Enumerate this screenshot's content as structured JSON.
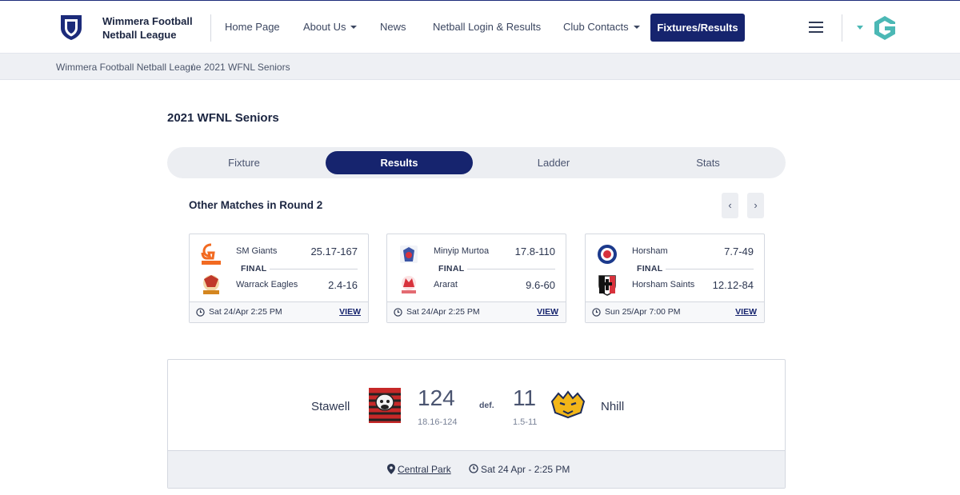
{
  "header": {
    "league_name": "Wimmera Football Netball League",
    "nav": [
      {
        "label": "Home Page",
        "has_dropdown": false
      },
      {
        "label": "About Us",
        "has_dropdown": true
      },
      {
        "label": "News",
        "has_dropdown": false
      },
      {
        "label": "Netball Login & Results",
        "has_dropdown": false
      },
      {
        "label": "Club Contacts",
        "has_dropdown": true
      }
    ],
    "cta_label": "Fixtures/Results",
    "icons": {
      "logo": "shield-icon",
      "menu": "hamburger-menu-icon",
      "brand": "gameday-g-logo"
    }
  },
  "breadcrumb": {
    "items": [
      "Wimmera Football Netball League",
      "2021 WFNL Seniors"
    ],
    "separator": "/"
  },
  "page": {
    "title": "2021 WFNL Seniors",
    "tabs": [
      "Fixture",
      "Results",
      "Ladder",
      "Stats"
    ],
    "active_tab": "Results"
  },
  "other_matches": {
    "title": "Other Matches in Round 2",
    "prev_icon": "‹",
    "next_icon": "›",
    "view_label": "VIEW",
    "matches": [
      {
        "status": "FINAL",
        "home": {
          "name": "SM Giants",
          "score": "25.17-167"
        },
        "away": {
          "name": "Warrack Eagles",
          "score": "2.4-16"
        },
        "datetime": "Sat 24/Apr  2:25 PM"
      },
      {
        "status": "FINAL",
        "home": {
          "name": "Minyip Murtoa",
          "score": "17.8-110"
        },
        "away": {
          "name": "Ararat",
          "score": "9.6-60"
        },
        "datetime": "Sat 24/Apr  2:25 PM"
      },
      {
        "status": "FINAL",
        "home": {
          "name": "Horsham",
          "score": "7.7-49"
        },
        "away": {
          "name": "Horsham Saints",
          "score": "12.12-84"
        },
        "datetime": "Sun 25/Apr  7:00 PM"
      }
    ]
  },
  "main_result": {
    "home": {
      "name": "Stawell",
      "score": "124",
      "detail": "18.16-124"
    },
    "away": {
      "name": "Nhill",
      "score": "11",
      "detail": "1.5-11"
    },
    "result_word": "def.",
    "venue": "Central Park",
    "datetime": "Sat 24 Apr - 2:25 PM"
  },
  "colors": {
    "primary": "#16246e",
    "background_alt": "#eef0f4",
    "brand_teal": "#4bb8b5"
  }
}
